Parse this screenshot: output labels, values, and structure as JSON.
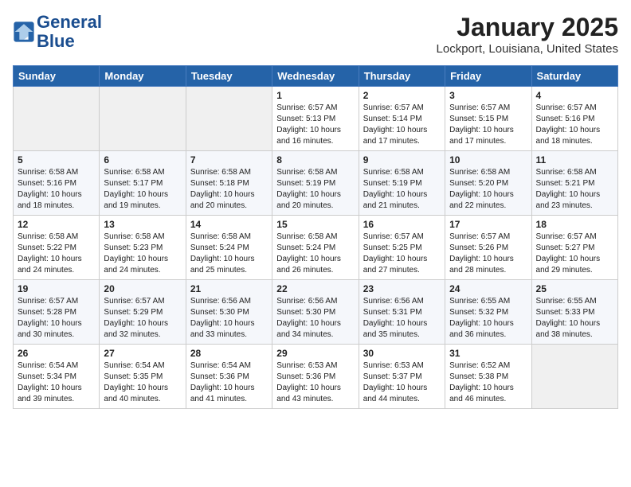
{
  "header": {
    "logo_line1": "General",
    "logo_line2": "Blue",
    "month_title": "January 2025",
    "location": "Lockport, Louisiana, United States"
  },
  "days_of_week": [
    "Sunday",
    "Monday",
    "Tuesday",
    "Wednesday",
    "Thursday",
    "Friday",
    "Saturday"
  ],
  "weeks": [
    [
      {
        "day": "",
        "info": ""
      },
      {
        "day": "",
        "info": ""
      },
      {
        "day": "",
        "info": ""
      },
      {
        "day": "1",
        "info": "Sunrise: 6:57 AM\nSunset: 5:13 PM\nDaylight: 10 hours\nand 16 minutes."
      },
      {
        "day": "2",
        "info": "Sunrise: 6:57 AM\nSunset: 5:14 PM\nDaylight: 10 hours\nand 17 minutes."
      },
      {
        "day": "3",
        "info": "Sunrise: 6:57 AM\nSunset: 5:15 PM\nDaylight: 10 hours\nand 17 minutes."
      },
      {
        "day": "4",
        "info": "Sunrise: 6:57 AM\nSunset: 5:16 PM\nDaylight: 10 hours\nand 18 minutes."
      }
    ],
    [
      {
        "day": "5",
        "info": "Sunrise: 6:58 AM\nSunset: 5:16 PM\nDaylight: 10 hours\nand 18 minutes."
      },
      {
        "day": "6",
        "info": "Sunrise: 6:58 AM\nSunset: 5:17 PM\nDaylight: 10 hours\nand 19 minutes."
      },
      {
        "day": "7",
        "info": "Sunrise: 6:58 AM\nSunset: 5:18 PM\nDaylight: 10 hours\nand 20 minutes."
      },
      {
        "day": "8",
        "info": "Sunrise: 6:58 AM\nSunset: 5:19 PM\nDaylight: 10 hours\nand 20 minutes."
      },
      {
        "day": "9",
        "info": "Sunrise: 6:58 AM\nSunset: 5:19 PM\nDaylight: 10 hours\nand 21 minutes."
      },
      {
        "day": "10",
        "info": "Sunrise: 6:58 AM\nSunset: 5:20 PM\nDaylight: 10 hours\nand 22 minutes."
      },
      {
        "day": "11",
        "info": "Sunrise: 6:58 AM\nSunset: 5:21 PM\nDaylight: 10 hours\nand 23 minutes."
      }
    ],
    [
      {
        "day": "12",
        "info": "Sunrise: 6:58 AM\nSunset: 5:22 PM\nDaylight: 10 hours\nand 24 minutes."
      },
      {
        "day": "13",
        "info": "Sunrise: 6:58 AM\nSunset: 5:23 PM\nDaylight: 10 hours\nand 24 minutes."
      },
      {
        "day": "14",
        "info": "Sunrise: 6:58 AM\nSunset: 5:24 PM\nDaylight: 10 hours\nand 25 minutes."
      },
      {
        "day": "15",
        "info": "Sunrise: 6:58 AM\nSunset: 5:24 PM\nDaylight: 10 hours\nand 26 minutes."
      },
      {
        "day": "16",
        "info": "Sunrise: 6:57 AM\nSunset: 5:25 PM\nDaylight: 10 hours\nand 27 minutes."
      },
      {
        "day": "17",
        "info": "Sunrise: 6:57 AM\nSunset: 5:26 PM\nDaylight: 10 hours\nand 28 minutes."
      },
      {
        "day": "18",
        "info": "Sunrise: 6:57 AM\nSunset: 5:27 PM\nDaylight: 10 hours\nand 29 minutes."
      }
    ],
    [
      {
        "day": "19",
        "info": "Sunrise: 6:57 AM\nSunset: 5:28 PM\nDaylight: 10 hours\nand 30 minutes."
      },
      {
        "day": "20",
        "info": "Sunrise: 6:57 AM\nSunset: 5:29 PM\nDaylight: 10 hours\nand 32 minutes."
      },
      {
        "day": "21",
        "info": "Sunrise: 6:56 AM\nSunset: 5:30 PM\nDaylight: 10 hours\nand 33 minutes."
      },
      {
        "day": "22",
        "info": "Sunrise: 6:56 AM\nSunset: 5:30 PM\nDaylight: 10 hours\nand 34 minutes."
      },
      {
        "day": "23",
        "info": "Sunrise: 6:56 AM\nSunset: 5:31 PM\nDaylight: 10 hours\nand 35 minutes."
      },
      {
        "day": "24",
        "info": "Sunrise: 6:55 AM\nSunset: 5:32 PM\nDaylight: 10 hours\nand 36 minutes."
      },
      {
        "day": "25",
        "info": "Sunrise: 6:55 AM\nSunset: 5:33 PM\nDaylight: 10 hours\nand 38 minutes."
      }
    ],
    [
      {
        "day": "26",
        "info": "Sunrise: 6:54 AM\nSunset: 5:34 PM\nDaylight: 10 hours\nand 39 minutes."
      },
      {
        "day": "27",
        "info": "Sunrise: 6:54 AM\nSunset: 5:35 PM\nDaylight: 10 hours\nand 40 minutes."
      },
      {
        "day": "28",
        "info": "Sunrise: 6:54 AM\nSunset: 5:36 PM\nDaylight: 10 hours\nand 41 minutes."
      },
      {
        "day": "29",
        "info": "Sunrise: 6:53 AM\nSunset: 5:36 PM\nDaylight: 10 hours\nand 43 minutes."
      },
      {
        "day": "30",
        "info": "Sunrise: 6:53 AM\nSunset: 5:37 PM\nDaylight: 10 hours\nand 44 minutes."
      },
      {
        "day": "31",
        "info": "Sunrise: 6:52 AM\nSunset: 5:38 PM\nDaylight: 10 hours\nand 46 minutes."
      },
      {
        "day": "",
        "info": ""
      }
    ]
  ]
}
